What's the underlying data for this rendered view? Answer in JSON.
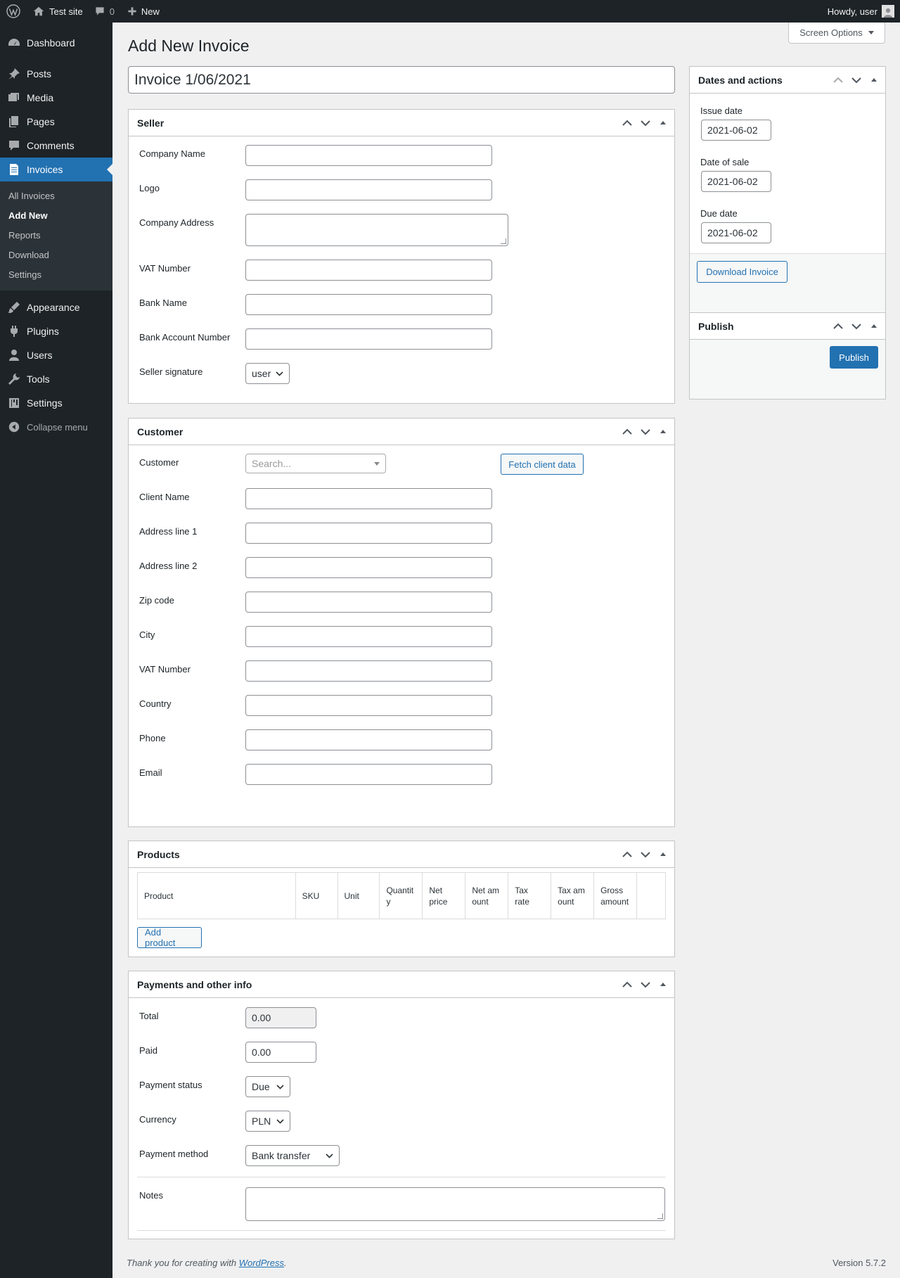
{
  "adminbar": {
    "site_name": "Test site",
    "comments_count": "0",
    "new_label": "New",
    "howdy": "Howdy, user"
  },
  "sidebar": {
    "items": [
      {
        "label": "Dashboard",
        "icon": "dashboard-icon"
      },
      {
        "label": "Posts",
        "icon": "pin-icon"
      },
      {
        "label": "Media",
        "icon": "media-icon"
      },
      {
        "label": "Pages",
        "icon": "pages-icon"
      },
      {
        "label": "Comments",
        "icon": "comment-icon"
      },
      {
        "label": "Invoices",
        "icon": "invoice-icon"
      },
      {
        "label": "Appearance",
        "icon": "brush-icon"
      },
      {
        "label": "Plugins",
        "icon": "plug-icon"
      },
      {
        "label": "Users",
        "icon": "user-icon"
      },
      {
        "label": "Tools",
        "icon": "wrench-icon"
      },
      {
        "label": "Settings",
        "icon": "sliders-icon"
      }
    ],
    "submenu": [
      "All Invoices",
      "Add New",
      "Reports",
      "Download",
      "Settings"
    ],
    "collapse_label": "Collapse menu"
  },
  "header": {
    "screen_options": "Screen Options",
    "page_title": "Add New Invoice",
    "invoice_title": "Invoice 1/06/2021"
  },
  "seller": {
    "title": "Seller",
    "labels": {
      "company_name": "Company Name",
      "logo": "Logo",
      "company_address": "Company Address",
      "vat_number": "VAT Number",
      "bank_name": "Bank Name",
      "bank_account": "Bank Account Number",
      "signature": "Seller signature"
    },
    "signature_value": "user"
  },
  "customer": {
    "title": "Customer",
    "labels": {
      "customer": "Customer",
      "client_name": "Client Name",
      "address1": "Address line 1",
      "address2": "Address line 2",
      "zip": "Zip code",
      "city": "City",
      "vat_number": "VAT Number",
      "country": "Country",
      "phone": "Phone",
      "email": "Email"
    },
    "search_placeholder": "Search...",
    "fetch_button": "Fetch client data"
  },
  "products": {
    "title": "Products",
    "columns": [
      "Product",
      "SKU",
      "Unit",
      "Quantity",
      "Net price",
      "Net amount",
      "Tax rate",
      "Tax amount",
      "Gross amount",
      ""
    ],
    "add_button": "Add product"
  },
  "payments": {
    "title": "Payments and other info",
    "labels": {
      "total": "Total",
      "paid": "Paid",
      "status": "Payment status",
      "currency": "Currency",
      "method": "Payment method",
      "notes": "Notes"
    },
    "total_value": "0.00",
    "paid_value": "0.00",
    "status_value": "Due",
    "currency_value": "PLN",
    "method_value": "Bank transfer"
  },
  "dates": {
    "title": "Dates and actions",
    "issue_label": "Issue date",
    "issue_value": "2021-06-02",
    "sale_label": "Date of sale",
    "sale_value": "2021-06-02",
    "due_label": "Due date",
    "due_value": "2021-06-02",
    "download_button": "Download Invoice"
  },
  "publish": {
    "title": "Publish",
    "button": "Publish"
  },
  "footer": {
    "thanks_prefix": "Thank you for creating with ",
    "thanks_link": "WordPress",
    "thanks_suffix": ".",
    "version": "Version 5.7.2"
  }
}
